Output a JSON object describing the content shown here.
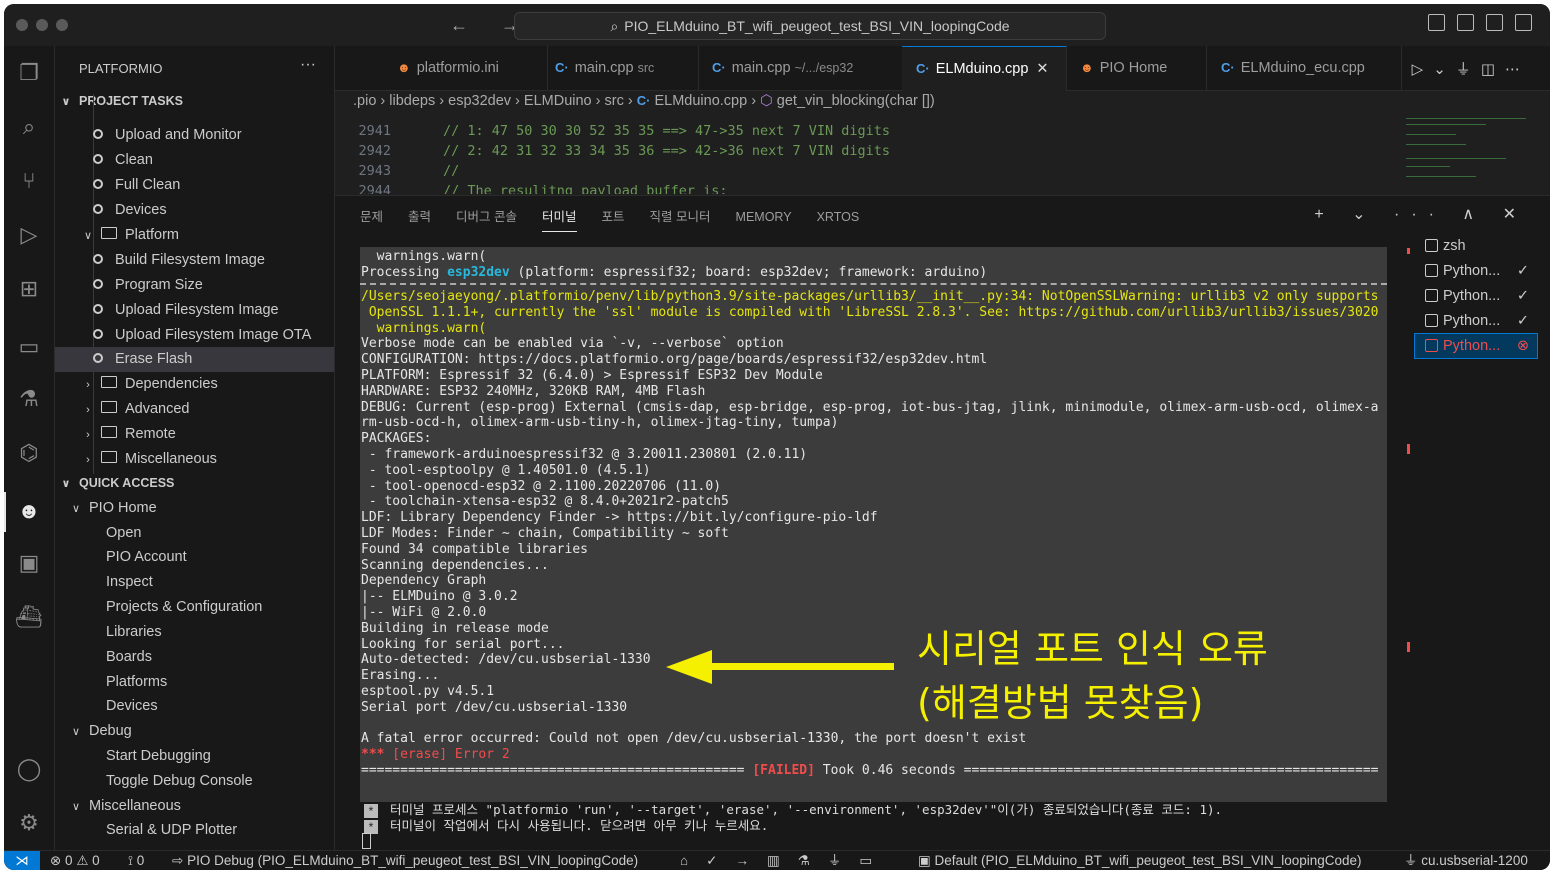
{
  "window": {
    "title": "PIO_ELMduino_BT_wifi_peugeot_test_BSI_VIN_loopingCode",
    "nav_arrows": "← →"
  },
  "sidebar": {
    "title": "PLATFORMIO",
    "more": "···",
    "project_tasks_header": "PROJECT TASKS",
    "items": [
      {
        "label": "Upload and Monitor"
      },
      {
        "label": "Clean"
      },
      {
        "label": "Full Clean"
      },
      {
        "label": "Devices"
      },
      {
        "label": "Platform"
      },
      {
        "label": "Build Filesystem Image"
      },
      {
        "label": "Program Size"
      },
      {
        "label": "Upload Filesystem Image"
      },
      {
        "label": "Upload Filesystem Image OTA"
      },
      {
        "label": "Erase Flash"
      },
      {
        "label": "Dependencies"
      },
      {
        "label": "Advanced"
      },
      {
        "label": "Remote"
      },
      {
        "label": "Miscellaneous"
      }
    ],
    "quick_access_header": "QUICK ACCESS",
    "quick": [
      {
        "label": "PIO Home"
      },
      {
        "label": "Open"
      },
      {
        "label": "PIO Account"
      },
      {
        "label": "Inspect"
      },
      {
        "label": "Projects & Configuration"
      },
      {
        "label": "Libraries"
      },
      {
        "label": "Boards"
      },
      {
        "label": "Platforms"
      },
      {
        "label": "Devices"
      },
      {
        "label": "Debug"
      },
      {
        "label": "Start Debugging"
      },
      {
        "label": "Toggle Debug Console"
      },
      {
        "label": "Miscellaneous"
      },
      {
        "label": "Serial & UDP Plotter"
      }
    ]
  },
  "tabs": [
    {
      "icon": "pio-icon",
      "label": "platformio.ini",
      "sub": ""
    },
    {
      "icon": "cpp-icon",
      "label": "main.cpp",
      "sub": "src"
    },
    {
      "icon": "cpp-icon",
      "label": "main.cpp",
      "sub": "~/.../esp32"
    },
    {
      "icon": "cpp-icon",
      "label": "ELMduino.cpp",
      "sub": ""
    },
    {
      "icon": "pio-icon",
      "label": "PIO Home",
      "sub": ""
    },
    {
      "icon": "cpp-icon",
      "label": "ELMduino_ecu.cpp",
      "sub": ""
    }
  ],
  "breadcrumb": {
    "p1": ".pio",
    "p2": "libdeps",
    "p3": "esp32dev",
    "p4": "ELMDuino",
    "p5": "src",
    "p6": "ELMduino.cpp",
    "p7": "get_vin_blocking(char [])"
  },
  "code": [
    {
      "n": "2941",
      "text": "// 1: 47 50 30 30 52 35 35      ==> 47->35 next 7 VIN digits"
    },
    {
      "n": "2942",
      "text": "// 2: 42 31 32 33 34 35 36      ==> 42->36 next 7 VIN digits"
    },
    {
      "n": "2943",
      "text": "//"
    },
    {
      "n": "2944",
      "text": "// The resulitng payload buffer is:"
    }
  ],
  "panel": {
    "tabs": [
      "문제",
      "출력",
      "디버그 콘솔",
      "터미널",
      "포트",
      "직렬 모니터",
      "MEMORY",
      "XRTOS"
    ],
    "active_tab": "터미널",
    "actions": "+ ⌄ ··· ∧ ✕"
  },
  "terminal": {
    "lines": [
      "  warnings.warn(",
      "Processing ",
      "/Users/seojaeyong/.platformio/penv/lib/python3.9/site-packages/urllib3/__init__.py:34: NotOpenSSLWarning: urllib3 v2 only supports",
      " OpenSSL 1.1.1+, currently the 'ssl' module is compiled with 'LibreSSL 2.8.3'. See: https://github.com/urllib3/urllib3/issues/3020",
      "  warnings.warn(",
      "Verbose mode can be enabled via `-v, --verbose` option",
      "CONFIGURATION: https://docs.platformio.org/page/boards/espressif32/esp32dev.html",
      "PLATFORM: Espressif 32 (6.4.0) > Espressif ESP32 Dev Module",
      "HARDWARE: ESP32 240MHz, 320KB RAM, 4MB Flash",
      "DEBUG: Current (esp-prog) External (cmsis-dap, esp-bridge, esp-prog, iot-bus-jtag, jlink, minimodule, olimex-arm-usb-ocd, olimex-a",
      "rm-usb-ocd-h, olimex-arm-usb-tiny-h, olimex-jtag-tiny, tumpa)",
      "PACKAGES:",
      " - framework-arduinoespressif32 @ 3.20011.230801 (2.0.11)",
      " - tool-esptoolpy @ 1.40501.0 (4.5.1)",
      " - tool-openocd-esp32 @ 2.1100.20220706 (11.0)",
      " - toolchain-xtensa-esp32 @ 8.4.0+2021r2-patch5",
      "LDF: Library Dependency Finder -> https://bit.ly/configure-pio-ldf",
      "LDF Modes: Finder ~ chain, Compatibility ~ soft",
      "Found 34 compatible libraries",
      "Scanning dependencies...",
      "Dependency Graph",
      "|-- ELMDuino @ 3.0.2",
      "|-- WiFi @ 2.0.0",
      "Building in release mode",
      "Looking for serial port...",
      "Auto-detected: /dev/cu.usbserial-1330",
      "Erasing...",
      "esptool.py v4.5.1",
      "Serial port /dev/cu.usbserial-1330",
      "",
      "A fatal error occurred: Could not open /dev/cu.usbserial-1330, the port doesn't exist"
    ],
    "processing_env": "esp32dev",
    "processing_rest": " (platform: espressif32; board: esp32dev; framework: arduino)",
    "err_stars": "***",
    "err_text": " [erase] Error 2",
    "fail_left": "================================================= ",
    "fail_tag": "[FAILED]",
    "fail_right": " Took 0.46 seconds =====================================================",
    "exit_line1": "터미널 프로세스 \"platformio 'run', '--target', 'erase', '--environment', 'esp32dev'\"이(가) 종료되었습니다(종료 코드: 1).",
    "exit_line2": "터미널이 작업에서 다시 사용됩니다. 닫으려면 아무 키나 누르세요.",
    "star_glyph": "*"
  },
  "terminal_list": [
    {
      "label": "zsh",
      "state": ""
    },
    {
      "label": "Python...",
      "state": "✓"
    },
    {
      "label": "Python...",
      "state": "✓"
    },
    {
      "label": "Python...",
      "state": "✓"
    },
    {
      "label": "Python...",
      "state": "⊗"
    }
  ],
  "annotation": {
    "line1": "시리얼 포트 인식 오류",
    "line2": "(해결방법 못찾음)",
    "color": "#f5ef00"
  },
  "statusbar": {
    "remote": "⋊",
    "problems": "⊗ 0 ⚠ 0",
    "ports": "⟟ 0",
    "debug": "PIO Debug (PIO_ELMduino_BT_wifi_peugeot_test_BSI_VIN_loopingCode)",
    "env": "Default (PIO_ELMduino_BT_wifi_peugeot_test_BSI_VIN_loopingCode)",
    "port": "cu.usbserial-1200"
  },
  "colors": {
    "accent": "#0078d4",
    "terminal_bg": "#3c3c3c",
    "warning_yellow": "#e5e510",
    "error_red": "#f14c4c",
    "env_cyan": "#29b8db"
  }
}
